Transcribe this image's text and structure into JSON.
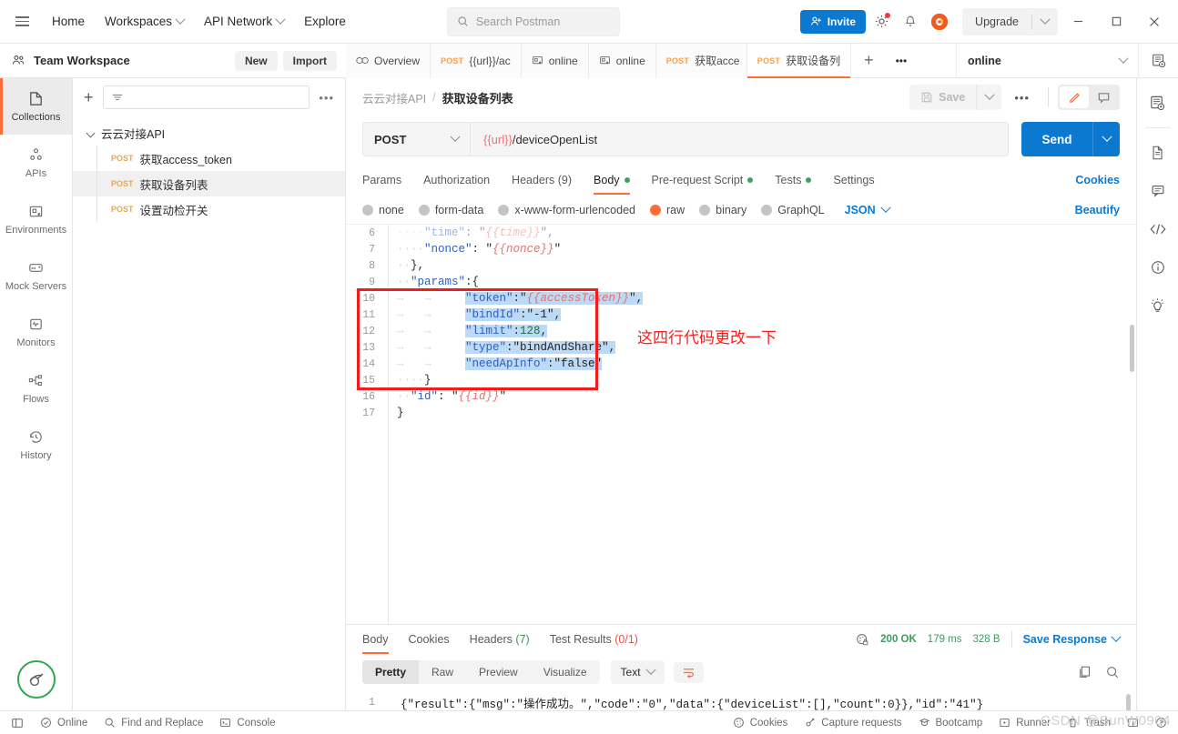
{
  "topbar": {
    "menu_icon": "hamburger-icon",
    "nav": [
      {
        "label": "Home",
        "caret": false
      },
      {
        "label": "Workspaces",
        "caret": true
      },
      {
        "label": "API Network",
        "caret": true
      },
      {
        "label": "Explore",
        "caret": false
      }
    ],
    "search": {
      "placeholder": "Search Postman",
      "value": "",
      "icon": "search-icon"
    },
    "invite_label": "Invite",
    "settings_icon": "gear-icon",
    "notifications_icon": "bell-icon",
    "avatar_icon": "user-avatar",
    "upgrade_label": "Upgrade",
    "window": {
      "minimize": "—",
      "maximize": "□",
      "close": "✕"
    }
  },
  "workspace": {
    "name": "Team Workspace",
    "icon": "team-icon",
    "new_label": "New",
    "import_label": "Import"
  },
  "tabs": [
    {
      "label": "Overview",
      "method": "",
      "icon": "overview-icon",
      "active": false
    },
    {
      "label": "{{url}}/ac",
      "method": "POST",
      "icon": "",
      "active": false
    },
    {
      "label": "online",
      "method": "",
      "icon": "environment-icon",
      "active": false
    },
    {
      "label": "online",
      "method": "",
      "icon": "environment-icon",
      "active": false
    },
    {
      "label": "获取acce",
      "method": "POST",
      "icon": "",
      "active": false
    },
    {
      "label": "获取设备列",
      "method": "POST",
      "icon": "",
      "active": true
    }
  ],
  "tab_plus": "+",
  "tab_more": "•••",
  "environment": {
    "selected": "online",
    "eye_icon": "eye-preview-icon"
  },
  "rail": [
    {
      "label": "Collections",
      "icon": "collections-icon",
      "active": true
    },
    {
      "label": "APIs",
      "icon": "apis-icon",
      "active": false
    },
    {
      "label": "Environments",
      "icon": "environments-icon",
      "active": false
    },
    {
      "label": "Mock Servers",
      "icon": "mock-servers-icon",
      "active": false
    },
    {
      "label": "Monitors",
      "icon": "monitors-icon",
      "active": false
    },
    {
      "label": "Flows",
      "icon": "flows-icon",
      "active": false
    },
    {
      "label": "History",
      "icon": "history-icon",
      "active": false
    }
  ],
  "sidebar": {
    "add_icon": "plus-icon",
    "filter_placeholder": "",
    "filter_icon": "filter-icon",
    "more_icon": "more-options-icon",
    "collection": {
      "name": "云云对接API",
      "expanded": true
    },
    "requests": [
      {
        "method": "POST",
        "name": "获取access_token",
        "selected": false
      },
      {
        "method": "POST",
        "name": "获取设备列表",
        "selected": true
      },
      {
        "method": "POST",
        "name": "设置动检开关",
        "selected": false
      }
    ]
  },
  "breadcrumb": {
    "collection": "云云对接API",
    "separator": "/",
    "current": "获取设备列表"
  },
  "request_actions": {
    "save_label": "Save",
    "more_label": "•••",
    "edit_icon": "pencil-icon",
    "comment_icon": "comment-icon"
  },
  "request": {
    "method": "POST",
    "url_variable": "{{url}}",
    "url_path": "/deviceOpenList",
    "send_label": "Send"
  },
  "request_tabs": [
    {
      "label": "Params",
      "dot": false,
      "active": false
    },
    {
      "label": "Authorization",
      "dot": false,
      "active": false
    },
    {
      "label": "Headers (9)",
      "dot": false,
      "active": false
    },
    {
      "label": "Body",
      "dot": true,
      "active": true
    },
    {
      "label": "Pre-request Script",
      "dot": true,
      "active": false
    },
    {
      "label": "Tests",
      "dot": true,
      "active": false
    },
    {
      "label": "Settings",
      "dot": false,
      "active": false
    }
  ],
  "cookies_link": "Cookies",
  "body_types": [
    {
      "label": "none",
      "selected": false
    },
    {
      "label": "form-data",
      "selected": false
    },
    {
      "label": "x-www-form-urlencoded",
      "selected": false
    },
    {
      "label": "raw",
      "selected": true
    },
    {
      "label": "binary",
      "selected": false
    },
    {
      "label": "GraphQL",
      "selected": false
    }
  ],
  "body_format": "JSON",
  "beautify_label": "Beautify",
  "editor": {
    "lines": [
      {
        "num": "6",
        "text": "\"time\": \"{{time}}\",",
        "indent": 2,
        "clipped": true
      },
      {
        "num": "7",
        "text": "\"nonce\": \"{{nonce}}\"",
        "indent": 2
      },
      {
        "num": "8",
        "text": "},",
        "indent": 1
      },
      {
        "num": "9",
        "text": "\"params\":{",
        "indent": 1
      },
      {
        "num": "10",
        "text": "\"token\":\"{{accessToken}}\",",
        "indent": 3,
        "highlight": true
      },
      {
        "num": "11",
        "text": "\"bindId\":\"-1\",",
        "indent": 3,
        "highlight": true
      },
      {
        "num": "12",
        "text": "\"limit\":128,",
        "indent": 3,
        "highlight": true
      },
      {
        "num": "13",
        "text": "\"type\":\"bindAndShare\",",
        "indent": 3,
        "highlight": true
      },
      {
        "num": "14",
        "text": "\"needApInfo\":\"false\"",
        "indent": 3,
        "highlight": true
      },
      {
        "num": "15",
        "text": "}",
        "indent": 2
      },
      {
        "num": "16",
        "text": "\"id\": \"{{id}}\"",
        "indent": 1
      },
      {
        "num": "17",
        "text": "}",
        "indent": 0
      }
    ],
    "annotation": "这四行代码更改一下",
    "annotation_color": "#fb1d1d",
    "highlight_box_color": "#f31b1b"
  },
  "response_tabs": [
    {
      "label": "Body",
      "count": "",
      "active": true
    },
    {
      "label": "Cookies",
      "count": "",
      "active": false
    },
    {
      "label": "Headers",
      "count": "(7)",
      "count_color": "green",
      "active": false
    },
    {
      "label": "Test Results",
      "count": "(0/1)",
      "count_color": "red",
      "active": false
    }
  ],
  "response_meta": {
    "shield_icon": "cookie-lock-icon",
    "status": "200 OK",
    "time": "179 ms",
    "size": "328 B",
    "save_response_label": "Save Response"
  },
  "response_view": {
    "segments": [
      {
        "label": "Pretty",
        "active": true
      },
      {
        "label": "Raw",
        "active": false
      },
      {
        "label": "Preview",
        "active": false
      },
      {
        "label": "Visualize",
        "active": false
      }
    ],
    "format": "Text",
    "wrap_icon": "word-wrap-icon",
    "copy_icon": "copy-icon",
    "search_icon": "search-icon"
  },
  "response_body": {
    "line_num": "1",
    "text": "{\"result\":{\"msg\":\"操作成功。\",\"code\":\"0\",\"data\":{\"deviceList\":[],\"count\":0}},\"id\":\"41\"}"
  },
  "footer": {
    "left": [
      {
        "label": "Online",
        "icon": "check-circle-icon"
      },
      {
        "label": "Find and Replace",
        "icon": "search-icon"
      },
      {
        "label": "Console",
        "icon": "console-icon"
      }
    ],
    "sidebar_toggle_icon": "sidebar-toggle-icon",
    "right": [
      {
        "label": "Cookies",
        "icon": "cookies-icon"
      },
      {
        "label": "Capture requests",
        "icon": "capture-icon"
      },
      {
        "label": "Bootcamp",
        "icon": "bootcamp-icon"
      },
      {
        "label": "Runner",
        "icon": "runner-icon"
      },
      {
        "label": "Trash",
        "icon": "trash-icon"
      },
      {
        "label": "",
        "icon": "layout-icon"
      },
      {
        "label": "",
        "icon": "help-icon"
      }
    ],
    "watermark": "CSDN @SunW0904"
  },
  "right_rail": [
    {
      "icon": "documentation-preview-icon"
    },
    {
      "icon": "document-icon"
    },
    {
      "icon": "comment-icon"
    },
    {
      "icon": "code-icon"
    },
    {
      "icon": "info-icon"
    },
    {
      "icon": "lightbulb-icon"
    }
  ],
  "colors": {
    "accent": "#ff6c37",
    "link": "#0b79d0",
    "method": "#f0a93b",
    "success": "#3c9b5c",
    "danger": "#e8534a",
    "highlight": "#bcd9f5"
  }
}
